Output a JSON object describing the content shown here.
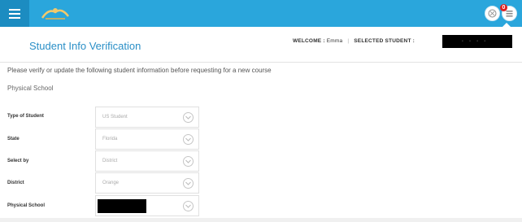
{
  "header": {
    "title": "Student Info Verification",
    "welcome_label": "WELCOME :",
    "welcome_name": "Emma",
    "selected_student_label": "SELECTED STUDENT :"
  },
  "topbar": {
    "notification_count": "0"
  },
  "main": {
    "intro": "Please verify or update the following student information before requesting for a new course",
    "section_title": "Physical School",
    "fields": [
      {
        "label": "Type of Student",
        "value": "US Student"
      },
      {
        "label": "State",
        "value": "Florida"
      },
      {
        "label": "Select by",
        "value": "District"
      },
      {
        "label": "District",
        "value": "Orange"
      },
      {
        "label": "Physical School",
        "value": ""
      }
    ]
  },
  "colors": {
    "topbar": "#2aa6dc",
    "accent": "#2a8fc7"
  },
  "icons": [
    "menu-icon",
    "logo",
    "user-icon",
    "notification-icon",
    "chevron-down-icon"
  ]
}
